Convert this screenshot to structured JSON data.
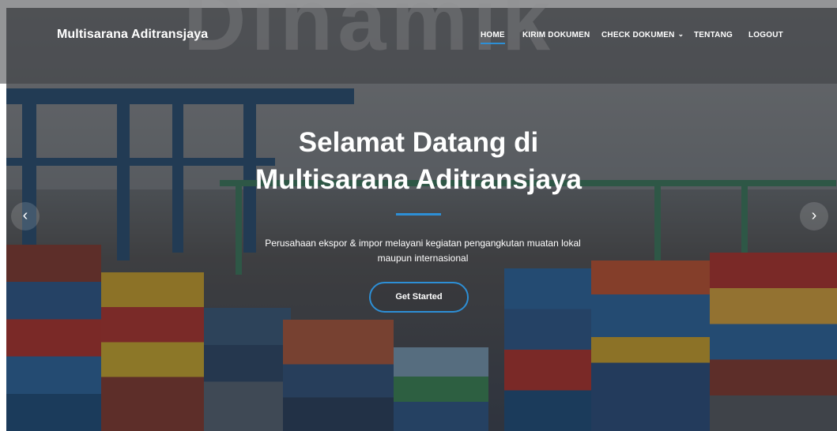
{
  "header": {
    "brand": "Multisarana Aditransjaya",
    "nav": [
      {
        "label": "HOME",
        "active": true
      },
      {
        "label": "KIRIM DOKUMEN",
        "active": false
      },
      {
        "label": "CHECK DOKUMEN",
        "active": false,
        "has_dropdown": true
      },
      {
        "label": "TENTANG",
        "active": false
      },
      {
        "label": "LOGOUT",
        "active": false
      }
    ]
  },
  "hero": {
    "title_line1": "Selamat Datang di",
    "title_line2": "Multisarana Aditransjaya",
    "subtitle_line1": "Perusahaan ekspor & impor melayani kegiatan pengangkutan muatan lokal",
    "subtitle_line2": "maupun internasional",
    "cta_label": "Get Started"
  },
  "carousel": {
    "prev_icon": "chevron-left-icon",
    "next_icon": "chevron-right-icon"
  },
  "colors": {
    "accent": "#2d8fd6",
    "text": "#ffffff"
  }
}
